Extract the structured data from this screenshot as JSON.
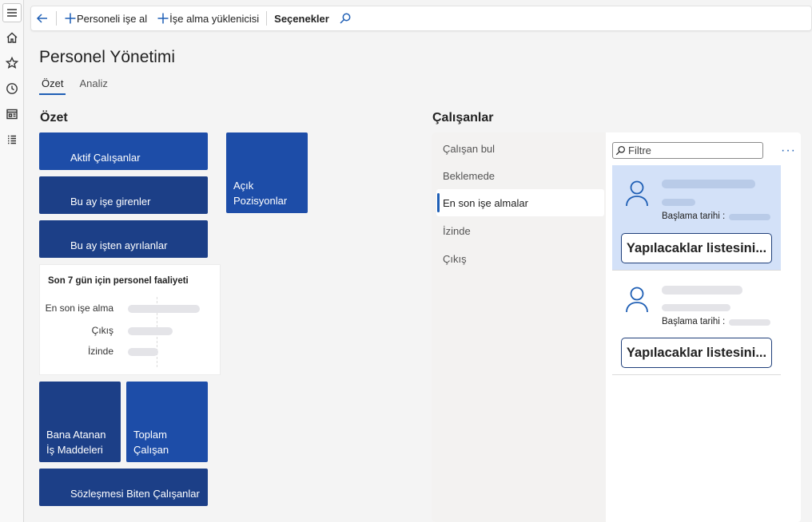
{
  "rail": {
    "items": [
      {
        "icon": "hamburger-menu-icon"
      },
      {
        "icon": "home-icon"
      },
      {
        "icon": "star-icon"
      },
      {
        "icon": "clock-icon"
      },
      {
        "icon": "workspace-icon"
      },
      {
        "icon": "list-icon"
      }
    ]
  },
  "toolbar": {
    "back_icon": "arrow-left-icon",
    "hire_label": "Personeli işe al",
    "hiring_manager_label": "İşe alma yüklenicisi",
    "options_label": "Seçenekler",
    "search_icon": "search-icon"
  },
  "page": {
    "title": "Personel Yönetimi",
    "tabs": [
      {
        "label": "Özet",
        "active": true
      },
      {
        "label": "Analiz",
        "active": false
      }
    ]
  },
  "summary": {
    "heading": "Özet",
    "tiles": {
      "active_employees": "Aktif Çalışanlar",
      "open_positions": "Açık Pozisyonlar",
      "new_this_month": "Bu ay işe girenler",
      "left_this_month": "Bu ay işten ayrılanlar",
      "assigned_work_items": "Bana Atanan İş Maddeleri",
      "total_employees": "Toplam Çalışan",
      "expiring_contracts": "Sözleşmesi Biten Çalışanlar"
    },
    "activity": {
      "title": "Son 7 gün için personel faaliyeti",
      "rows": [
        {
          "label": "En son işe alma"
        },
        {
          "label": "Çıkış"
        },
        {
          "label": "İzinde"
        }
      ]
    }
  },
  "employees": {
    "heading": "Çalışanlar",
    "nav": [
      {
        "label": "Çalışan bul",
        "active": false
      },
      {
        "label": "Beklemede",
        "active": false
      },
      {
        "label": "En son işe almalar",
        "active": true
      },
      {
        "label": "İzinde",
        "active": false
      },
      {
        "label": "Çıkış",
        "active": false
      }
    ],
    "filter_placeholder": "Filtre",
    "more_label": "···",
    "cards": [
      {
        "start_label": "Başlama tarihi :",
        "button": "Yapılacaklar listesini...",
        "selected": true
      },
      {
        "start_label": "Başlama tarihi :",
        "button": "Yapılacaklar listesini...",
        "selected": false
      }
    ]
  },
  "colors": {
    "accent": "#1f5fb5",
    "tile_dark": "#1c3f87",
    "tile_mid": "#1d4da8",
    "selected_card": "#d3e1f8"
  }
}
